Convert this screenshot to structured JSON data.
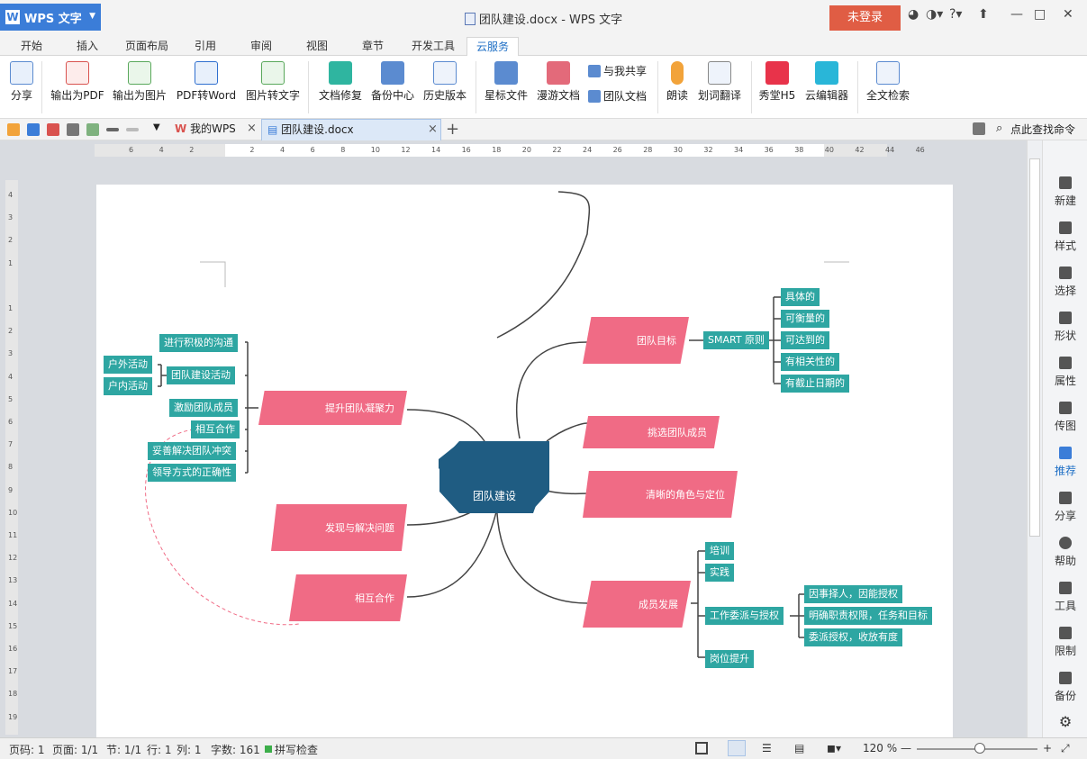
{
  "app": {
    "menu_label": "WPS 文字",
    "logo": "W",
    "title": "团队建设.docx - WPS 文字",
    "login": "未登录"
  },
  "tabs": [
    "开始",
    "插入",
    "页面布局",
    "引用",
    "审阅",
    "视图",
    "章节",
    "开发工具",
    "云服务"
  ],
  "active_tab": "云服务",
  "ribbon": {
    "buttons": [
      "分享",
      "输出为PDF",
      "输出为图片",
      "PDF转Word",
      "图片转文字",
      "文档修复",
      "备份中心",
      "历史版本",
      "星标文件",
      "漫游文档",
      "朗读",
      "划词翻译",
      "秀堂H5",
      "云编辑器",
      "全文检索"
    ],
    "small": [
      "与我共享",
      "团队文档"
    ]
  },
  "doctabs": {
    "wps": "我的WPS",
    "file": "团队建设.docx",
    "search": "点此查找命令"
  },
  "ruler_h": [
    "6",
    "4",
    "2",
    "",
    "2",
    "4",
    "6",
    "8",
    "10",
    "12",
    "14",
    "16",
    "18",
    "20",
    "22",
    "24",
    "26",
    "28",
    "30",
    "32",
    "34",
    "36",
    "38",
    "40",
    "42",
    "44",
    "46"
  ],
  "ruler_v": [
    "4",
    "3",
    "2",
    "1",
    "",
    "1",
    "2",
    "3",
    "4",
    "5",
    "6",
    "7",
    "8",
    "9",
    "10",
    "11",
    "12",
    "13",
    "14",
    "15",
    "16",
    "17",
    "18",
    "19"
  ],
  "sidebar": [
    "新建",
    "样式",
    "选择",
    "形状",
    "属性",
    "传图",
    "推荐",
    "分享",
    "帮助",
    "工具",
    "限制",
    "备份"
  ],
  "status": {
    "page": "页码: 1",
    "pages": "页面: 1/1",
    "section": "节: 1/1",
    "row": "行: 1",
    "col": "列: 1",
    "words": "字数: 161",
    "spell": "拼写检查",
    "zoom": "120 %"
  },
  "mindmap": {
    "center": "团队建设",
    "goal": "团队目标",
    "smart": "SMART 原则",
    "smart_items": [
      "具体的",
      "可衡量的",
      "可达到的",
      "有相关性的",
      "有截止日期的"
    ],
    "select": "挑选团队成员",
    "role": "清晰的角色与定位",
    "develop": "成员发展",
    "develop_items": [
      "培训",
      "实践",
      "工作委派与授权",
      "岗位提升"
    ],
    "delegate_items": [
      "因事择人，因能授权",
      "明确职责权限，任务和目标",
      "委派授权，收放有度"
    ],
    "cohesion": "提升团队凝聚力",
    "cohesion_items": [
      "进行积极的沟通",
      "团队建设活动",
      "激励团队成员",
      "相互合作",
      "妥善解决团队冲突",
      "领导方式的正确性"
    ],
    "activity_items": [
      "户外活动",
      "户内活动"
    ],
    "solve": "发现与解决问题",
    "coop": "相互合作",
    "colors": {
      "teal": "#2ea6a2",
      "pink": "#f06b85",
      "center": "#1f5c82"
    }
  }
}
